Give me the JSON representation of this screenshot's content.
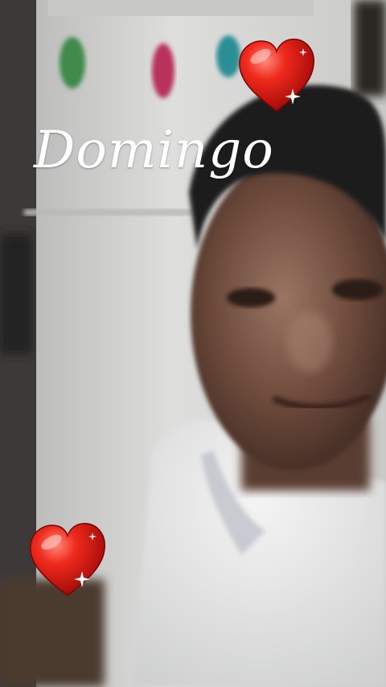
{
  "sticker_text": "Domingo",
  "stickers": [
    "heart-sticker",
    "heart-sticker"
  ],
  "colors": {
    "heart": "#d80f0f",
    "heart_highlight": "#ff6a5c",
    "text": "#ffffff",
    "wall": "#d8d9d7",
    "shirt": "#e9eaea",
    "skin": "#6b4a3a"
  }
}
